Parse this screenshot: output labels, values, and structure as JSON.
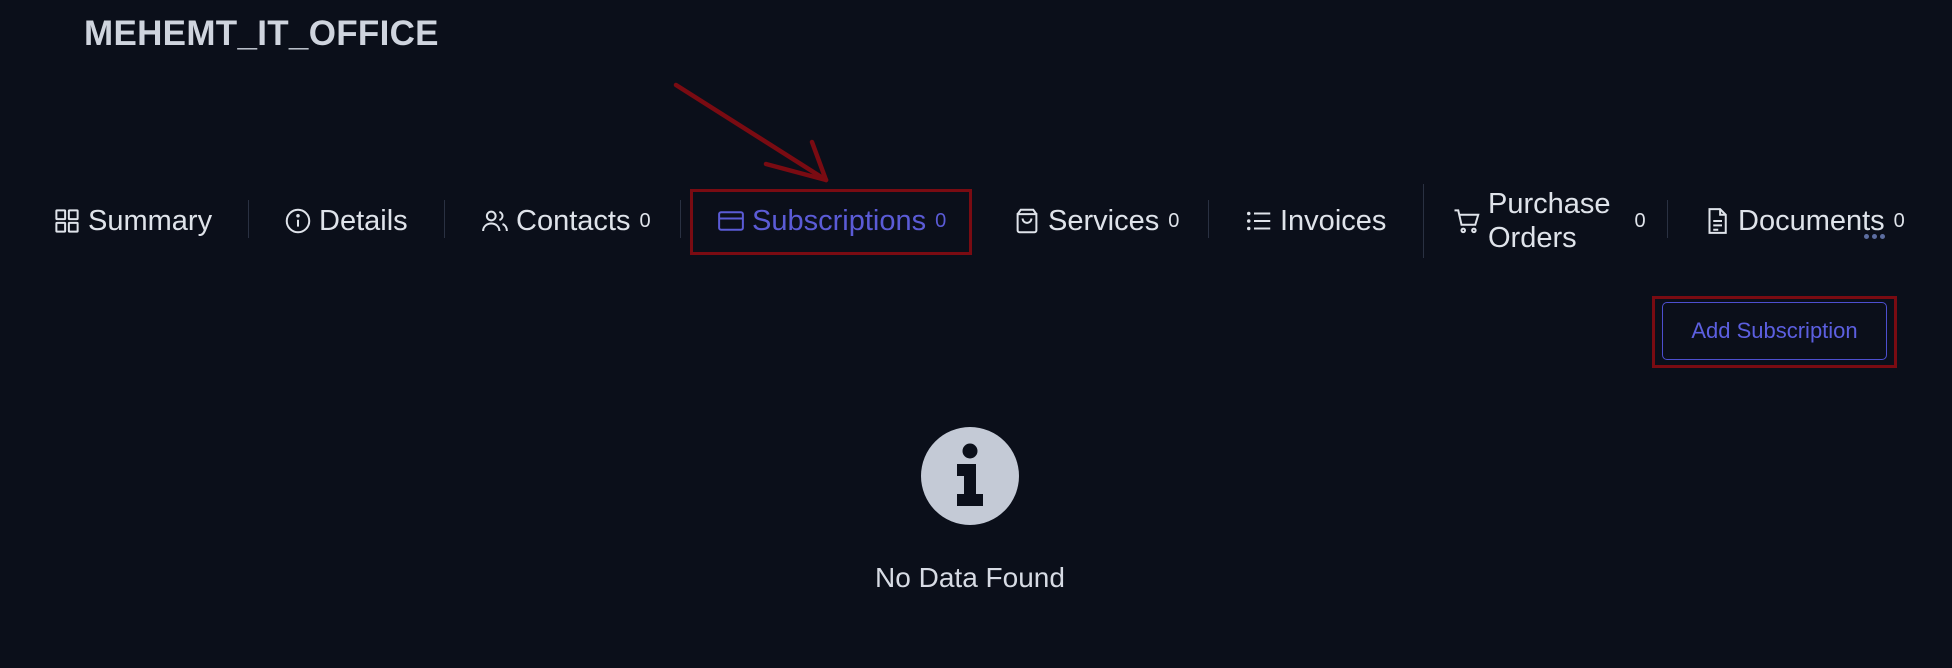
{
  "header": {
    "title": "MEHEMT_IT_OFFICE"
  },
  "tabs": [
    {
      "label": "Summary",
      "icon": "grid-icon",
      "count": null,
      "active": false
    },
    {
      "label": "Details",
      "icon": "info-circle-icon",
      "count": null,
      "active": false
    },
    {
      "label": "Contacts",
      "icon": "users-icon",
      "count": "0",
      "active": false
    },
    {
      "label": "Subscriptions",
      "icon": "credit-card-icon",
      "count": "0",
      "active": true
    },
    {
      "label": "Services",
      "icon": "shopping-bag-icon",
      "count": "0",
      "active": false
    },
    {
      "label": "Invoices",
      "icon": "list-icon",
      "count": null,
      "active": false
    },
    {
      "label_line1": "Purchase",
      "label_line2": "Orders",
      "icon": "cart-icon",
      "count": "0",
      "active": false
    },
    {
      "label": "Documents",
      "icon": "file-icon",
      "count": "0",
      "active": false
    }
  ],
  "actions": {
    "add_subscription_label": "Add Subscription"
  },
  "empty_state": {
    "icon": "info-icon",
    "message": "No Data Found"
  },
  "colors": {
    "background": "#0b0f1a",
    "accent": "#5b5bd6",
    "annotation": "#7a0b12",
    "text": "#dfe3ea"
  }
}
